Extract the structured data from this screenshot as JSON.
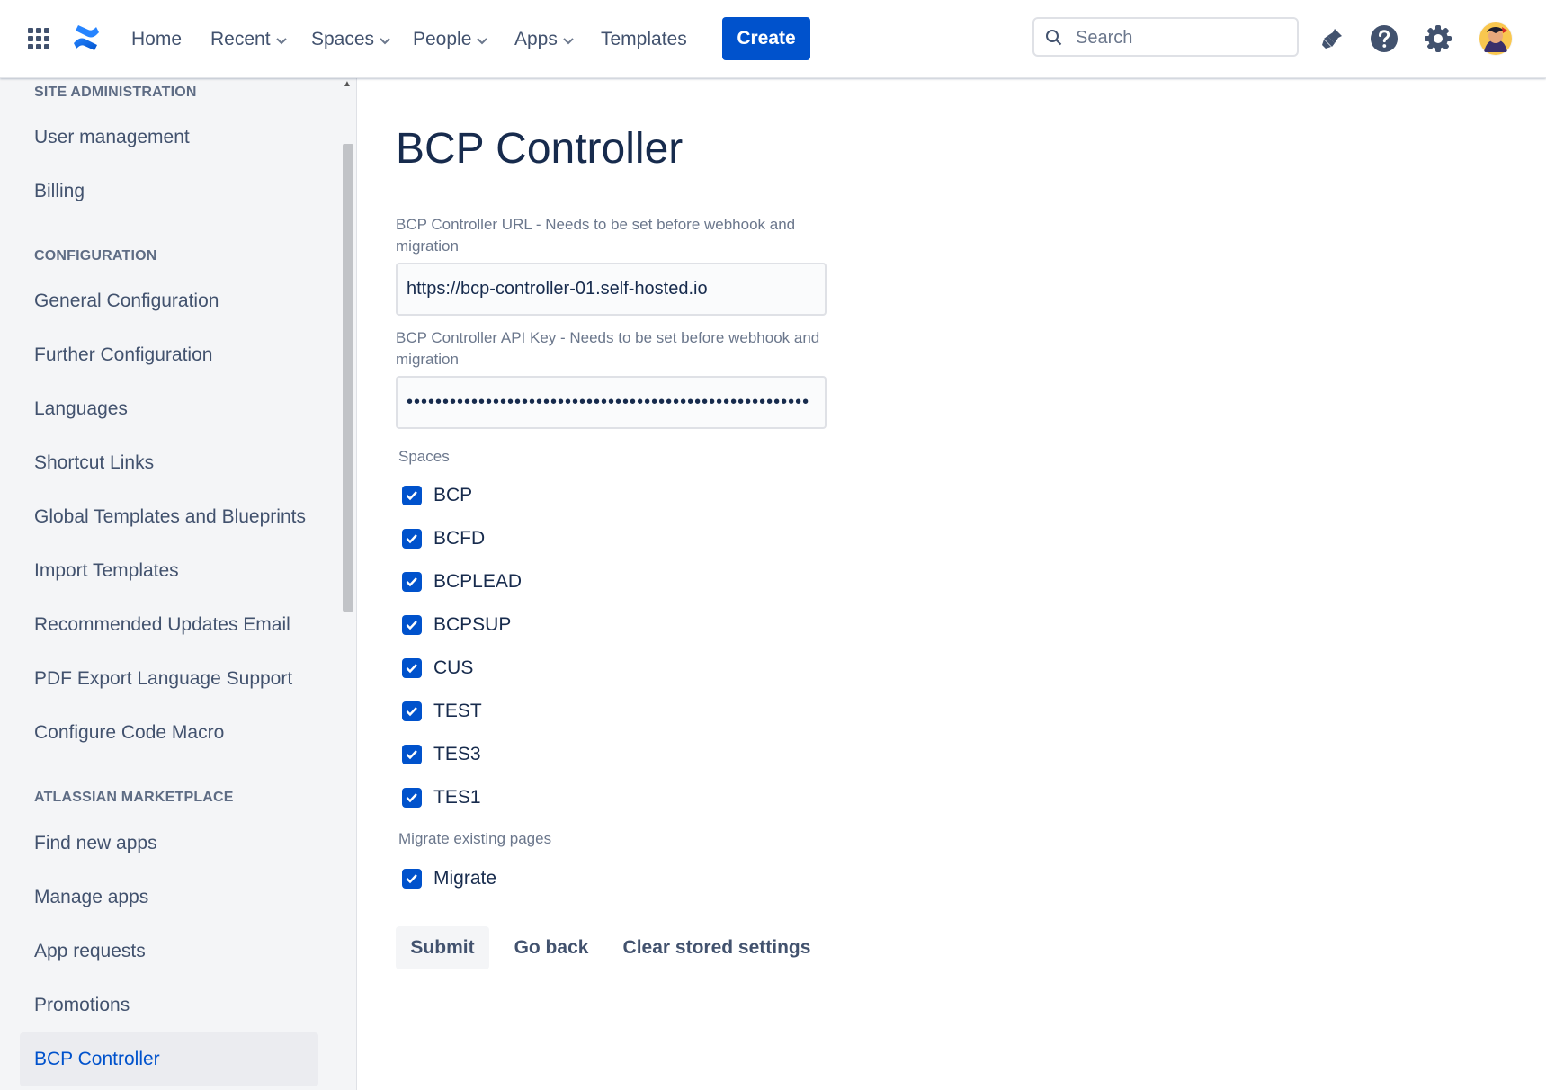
{
  "nav": {
    "items": [
      {
        "label": "Home"
      },
      {
        "label": "Recent"
      },
      {
        "label": "Spaces"
      },
      {
        "label": "People"
      },
      {
        "label": "Apps"
      },
      {
        "label": "Templates"
      }
    ],
    "create_label": "Create",
    "search_placeholder": "Search",
    "icons": [
      "app-switcher-icon",
      "confluence-logo",
      "notifications-icon",
      "help-icon",
      "settings-icon",
      "avatar"
    ]
  },
  "sidebar": {
    "sections": [
      {
        "heading": "SITE ADMINISTRATION",
        "items": [
          "User management",
          "Billing"
        ]
      },
      {
        "heading": "CONFIGURATION",
        "items": [
          "General Configuration",
          "Further Configuration",
          "Languages",
          "Shortcut Links",
          "Global Templates and Blueprints",
          "Import Templates",
          "Recommended Updates Email",
          "PDF Export Language Support",
          "Configure Code Macro"
        ]
      },
      {
        "heading": "ATLASSIAN MARKETPLACE",
        "items": [
          "Find new apps",
          "Manage apps",
          "App requests",
          "Promotions",
          "BCP Controller"
        ]
      }
    ],
    "active_item": "BCP Controller"
  },
  "main": {
    "title": "BCP Controller",
    "url_field": {
      "label": "BCP Controller URL - Needs to be set before webhook and migration",
      "value": "https://bcp-controller-01.self-hosted.io"
    },
    "api_key_field": {
      "label": "BCP Controller API Key - Needs to be set before webhook and migration",
      "value": "••••••••••••••••••••••••••••••••••••••••••••••••••••••••"
    },
    "spaces": {
      "label": "Spaces",
      "items": [
        {
          "label": "BCP",
          "checked": true
        },
        {
          "label": "BCFD",
          "checked": true
        },
        {
          "label": "BCPLEAD",
          "checked": true
        },
        {
          "label": "BCPSUP",
          "checked": true
        },
        {
          "label": "CUS",
          "checked": true
        },
        {
          "label": "TEST",
          "checked": true
        },
        {
          "label": "TES3",
          "checked": true
        },
        {
          "label": "TES1",
          "checked": true
        }
      ]
    },
    "migrate": {
      "label": "Migrate existing pages",
      "option": {
        "label": "Migrate",
        "checked": true
      }
    },
    "buttons": {
      "submit": "Submit",
      "go_back": "Go back",
      "clear": "Clear stored settings"
    }
  },
  "colors": {
    "accent": "#0052CC",
    "sidebar_bg": "#F4F5F7",
    "text": "#172B4D",
    "muted": "#6B778C"
  }
}
